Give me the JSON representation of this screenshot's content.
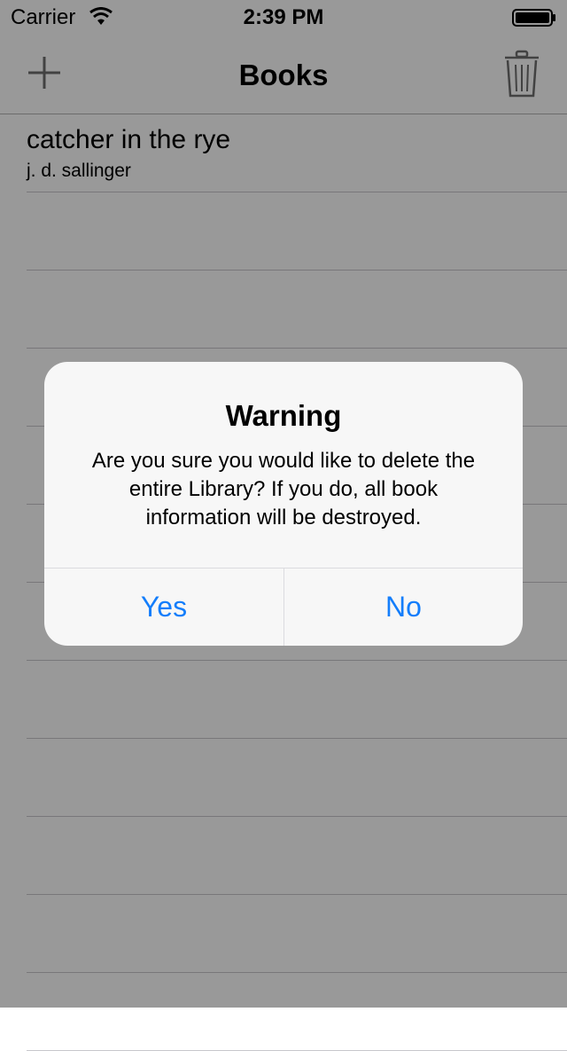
{
  "status_bar": {
    "carrier": "Carrier",
    "time": "2:39 PM"
  },
  "nav": {
    "title": "Books",
    "add_icon": "plus-icon",
    "trash_icon": "trash-icon"
  },
  "books": [
    {
      "title": "catcher in the rye",
      "author": "j. d. sallinger"
    }
  ],
  "alert": {
    "title": "Warning",
    "message": "Are you sure you would like to delete the entire Library? If you do, all book information will be destroyed.",
    "yes_label": "Yes",
    "no_label": "No"
  },
  "colors": {
    "accent": "#147efb",
    "overlay": "rgba(0,0,0,0.40)",
    "alert_bg": "#f7f7f7"
  }
}
